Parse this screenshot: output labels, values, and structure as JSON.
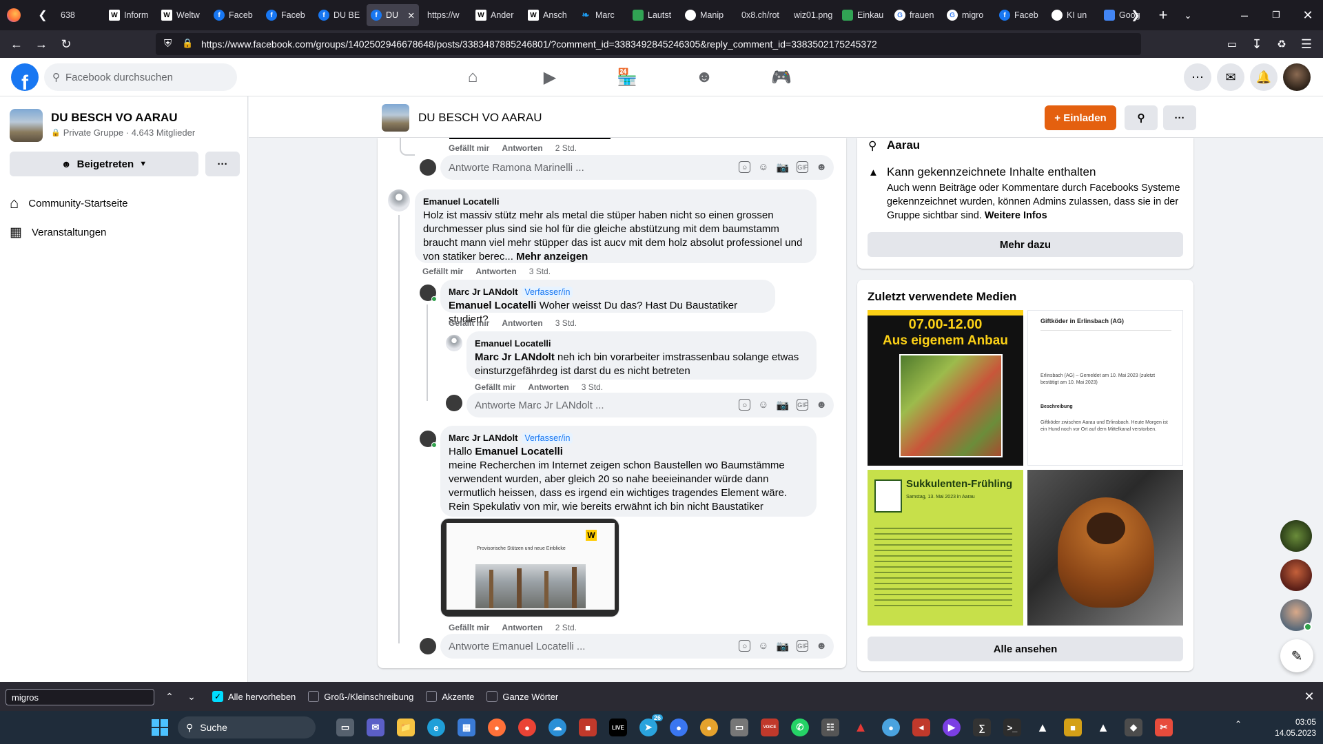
{
  "browser": {
    "tabs": [
      {
        "label": "638",
        "favicon": "none"
      },
      {
        "label": "Inform",
        "favicon": "W"
      },
      {
        "label": "Weltw",
        "favicon": "W"
      },
      {
        "label": "Faceb",
        "favicon": "f"
      },
      {
        "label": "Faceb",
        "favicon": "f"
      },
      {
        "label": "DU BE",
        "favicon": "f"
      },
      {
        "label": "DU",
        "favicon": "f"
      },
      {
        "label": "https://w",
        "favicon": "none"
      },
      {
        "label": "Ander",
        "favicon": "W"
      },
      {
        "label": "Ansch",
        "favicon": "W"
      },
      {
        "label": "Marc",
        "favicon": "bird"
      },
      {
        "label": "Lautst",
        "favicon": "gr"
      },
      {
        "label": "Manip",
        "favicon": "ai"
      },
      {
        "label": "0x8.ch/rot",
        "favicon": "none"
      },
      {
        "label": "wiz01.png",
        "favicon": "none"
      },
      {
        "label": "Einkau",
        "favicon": "gr"
      },
      {
        "label": "frauen",
        "favicon": "G"
      },
      {
        "label": "migro",
        "favicon": "G"
      },
      {
        "label": "Faceb",
        "favicon": "f"
      },
      {
        "label": "KI un",
        "favicon": "ai"
      },
      {
        "label": "Goog",
        "favicon": "gt"
      }
    ],
    "url": "https://www.facebook.com/groups/1402502946678648/posts/3383487885246801/?comment_id=3383492845246305&reply_comment_id=3383502175245372"
  },
  "facebook": {
    "logo": "f",
    "search_placeholder": "Facebook durchsuchen"
  },
  "group": {
    "name": "DU BESCH VO AARAU",
    "meta": "Private Gruppe · 4.643 Mitglieder",
    "joined_label": "Beigetreten",
    "more_label": "···",
    "nav": [
      {
        "label": "Community-Startseite",
        "icon": "home-icon"
      },
      {
        "label": "Veranstaltungen",
        "icon": "calendar-icon"
      }
    ],
    "invite_label": "+ Einladen"
  },
  "comments": {
    "reply_top_placeholder": "Antworte Ramona Marinelli ...",
    "top_actions": {
      "like": "Gefällt mir",
      "reply": "Antworten",
      "time": "2 Std."
    },
    "c1": {
      "author": "Emanuel Locatelli",
      "text": "Holz ist massiv stütz mehr als metal die stüper haben nicht so einen grossen durchmesser plus sind sie hol für die gleiche abstützung mit dem baumstamm braucht mann viel mehr stüpper das ist aucv mit dem holz absolut professionel und von statiker berec...",
      "more": "Mehr anzeigen",
      "like": "Gefällt mir",
      "reply": "Antworten",
      "time": "3 Std."
    },
    "c2": {
      "author": "Marc Jr LANdolt",
      "badge": "Verfasser/in",
      "mention": "Emanuel Locatelli",
      "text": "Woher weisst Du das? Hast Du Baustatiker studiert?",
      "like": "Gefällt mir",
      "reply": "Antworten",
      "time": "3 Std."
    },
    "c3": {
      "author": "Emanuel Locatelli",
      "mention": "Marc Jr LANdolt",
      "text": "neh ich bin vorarbeiter imstrassenbau solange etwas einsturzgefährdeg ist darst du es nicht betreten",
      "like": "Gefällt mir",
      "reply": "Antworten",
      "time": "3 Std."
    },
    "reply_mid_placeholder": "Antworte Marc Jr LANdolt ...",
    "c4": {
      "author": "Marc Jr LANdolt",
      "badge": "Verfasser/in",
      "greeting": "Hallo",
      "mention": "Emanuel Locatelli",
      "text": "meine Recherchen im Internet zeigen schon Baustellen wo Baumstämme verwendent wurden, aber gleich 20 so nahe beeieinander würde dann vermutlich heissen, dass es irgend ein wichtiges tragendes Element wäre. Rein Spekulativ von mir, wie bereits erwähnt ich bin nicht Baustatiker",
      "image_title": "Provisorische Stützen und neue Einblicke",
      "image_logo": "W",
      "like": "Gefällt mir",
      "reply": "Antworten",
      "time": "2 Std."
    },
    "reply_bottom_placeholder": "Antworte Emanuel Locatelli ..."
  },
  "about": {
    "location": "Aarau",
    "flag_title": "Kann gekennzeichnete Inhalte enthalten",
    "flag_text": "Auch wenn Beiträge oder Kommentare durch Facebooks Systeme gekennzeichnet wurden, können Admins zulassen, dass sie in der Gruppe sichtbar sind.",
    "flag_link": "Weitere Infos",
    "more_button": "Mehr dazu"
  },
  "media": {
    "title": "Zuletzt verwendete Medien",
    "tile1_top": "07.00-12.00",
    "tile1_sub": "Aus eigenem Anbau",
    "tile2_title": "Giftköder in Erlinsbach (AG)",
    "tile2_body": "Erlinsbach (AG) – Gemeldet am 10. Mai 2023 (zuletzt bestätigt am 10. Mai 2023)",
    "tile2_head2": "Beschreibung",
    "tile2_body2": "Giftköder zwischen Aarau und Erlinsbach. Heute Morgen ist ein Hund noch vor Ort auf dem Mittelkanal verstorben.",
    "tile3_title": "Sukkulenten-Frühling",
    "tile3_sub": "Samstag, 13. Mai 2023 in Aarau",
    "all_button": "Alle ansehen"
  },
  "findbar": {
    "query": "migros",
    "options": [
      {
        "label": "Alle hervorheben",
        "checked": true
      },
      {
        "label": "Groß-/Kleinschreibung",
        "checked": false
      },
      {
        "label": "Akzente",
        "checked": false
      },
      {
        "label": "Ganze Wörter",
        "checked": false
      }
    ]
  },
  "taskbar": {
    "search_label": "Suche",
    "time": "03:05",
    "date": "14.05.2023",
    "telegram_badge": "26"
  },
  "colors": {
    "facebook_blue": "#1877f2",
    "invite_orange": "#e4600f",
    "firefox_dark": "#1c1b22"
  }
}
